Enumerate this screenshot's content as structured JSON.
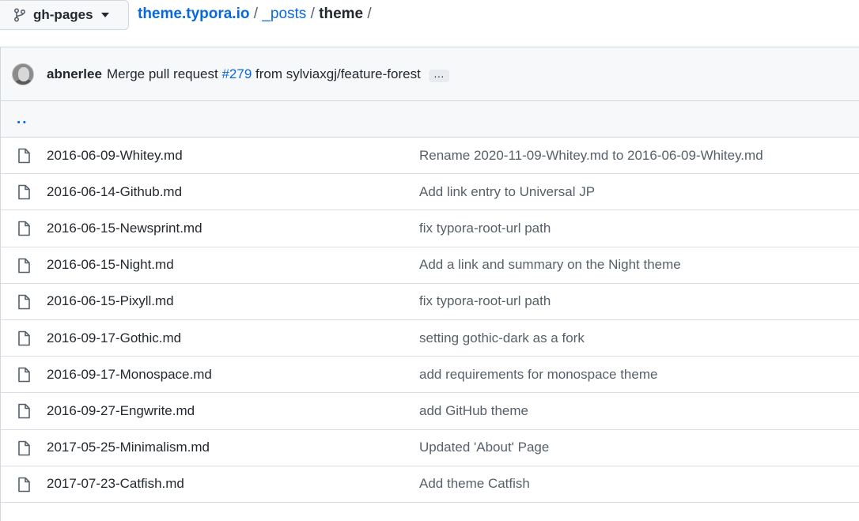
{
  "branch": {
    "name": "gh-pages"
  },
  "breadcrumb": {
    "root": "theme.typora.io",
    "sep1": " / ",
    "folder": "_posts",
    "sep2": " / ",
    "current": "theme",
    "sep3": " /"
  },
  "commit": {
    "author": "abnerlee",
    "message_prefix": "Merge pull request ",
    "pr": "#279",
    "message_suffix": " from sylviaxgj/feature-forest",
    "more": "…"
  },
  "parent_dir": "..",
  "files": [
    {
      "name": "2016-06-09-Whitey.md",
      "message": "Rename 2020-11-09-Whitey.md to 2016-06-09-Whitey.md"
    },
    {
      "name": "2016-06-14-Github.md",
      "message": "Add link entry to Universal JP"
    },
    {
      "name": "2016-06-15-Newsprint.md",
      "message": "fix typora-root-url path"
    },
    {
      "name": "2016-06-15-Night.md",
      "message": "Add a link and summary on the Night theme"
    },
    {
      "name": "2016-06-15-Pixyll.md",
      "message": "fix typora-root-url path"
    },
    {
      "name": "2016-09-17-Gothic.md",
      "message": "setting gothic-dark as a fork"
    },
    {
      "name": "2016-09-17-Monospace.md",
      "message": "add requirements for monospace theme"
    },
    {
      "name": "2016-09-27-Engwrite.md",
      "message": "add GitHub theme"
    },
    {
      "name": "2017-05-25-Minimalism.md",
      "message": "Updated 'About' Page"
    },
    {
      "name": "2017-07-23-Catfish.md",
      "message": "Add theme Catfish"
    }
  ]
}
